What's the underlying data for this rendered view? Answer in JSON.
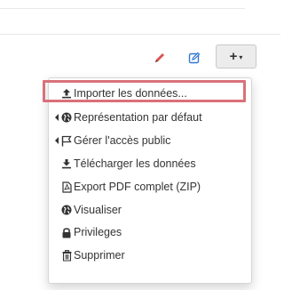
{
  "toolbar": {
    "pencil_icon": "pencil-icon",
    "edit_icon": "edit-square-icon",
    "add_label": "+",
    "add_caret": "▾",
    "accent_red": "#d9534f",
    "accent_blue": "#2f78d3"
  },
  "menu": {
    "items": [
      {
        "label": "Importer les données...",
        "icon": "upload-icon",
        "submenu": false,
        "highlighted": true
      },
      {
        "label": "Représentation par défaut",
        "icon": "globe-icon",
        "submenu": true
      },
      {
        "label": "Gérer l'accès public",
        "icon": "flag-icon",
        "submenu": true
      },
      {
        "label": "Télécharger les données",
        "icon": "download-icon",
        "submenu": false
      },
      {
        "label": "Export PDF complet (ZIP)",
        "icon": "pdf-file-icon",
        "submenu": false
      },
      {
        "label": "Visualiser",
        "icon": "globe-icon",
        "submenu": false
      },
      {
        "label": "Privileges",
        "icon": "lock-icon",
        "submenu": false
      },
      {
        "label": "Supprimer",
        "icon": "trash-icon",
        "submenu": false
      }
    ],
    "highlight_color": "#d9717a"
  }
}
